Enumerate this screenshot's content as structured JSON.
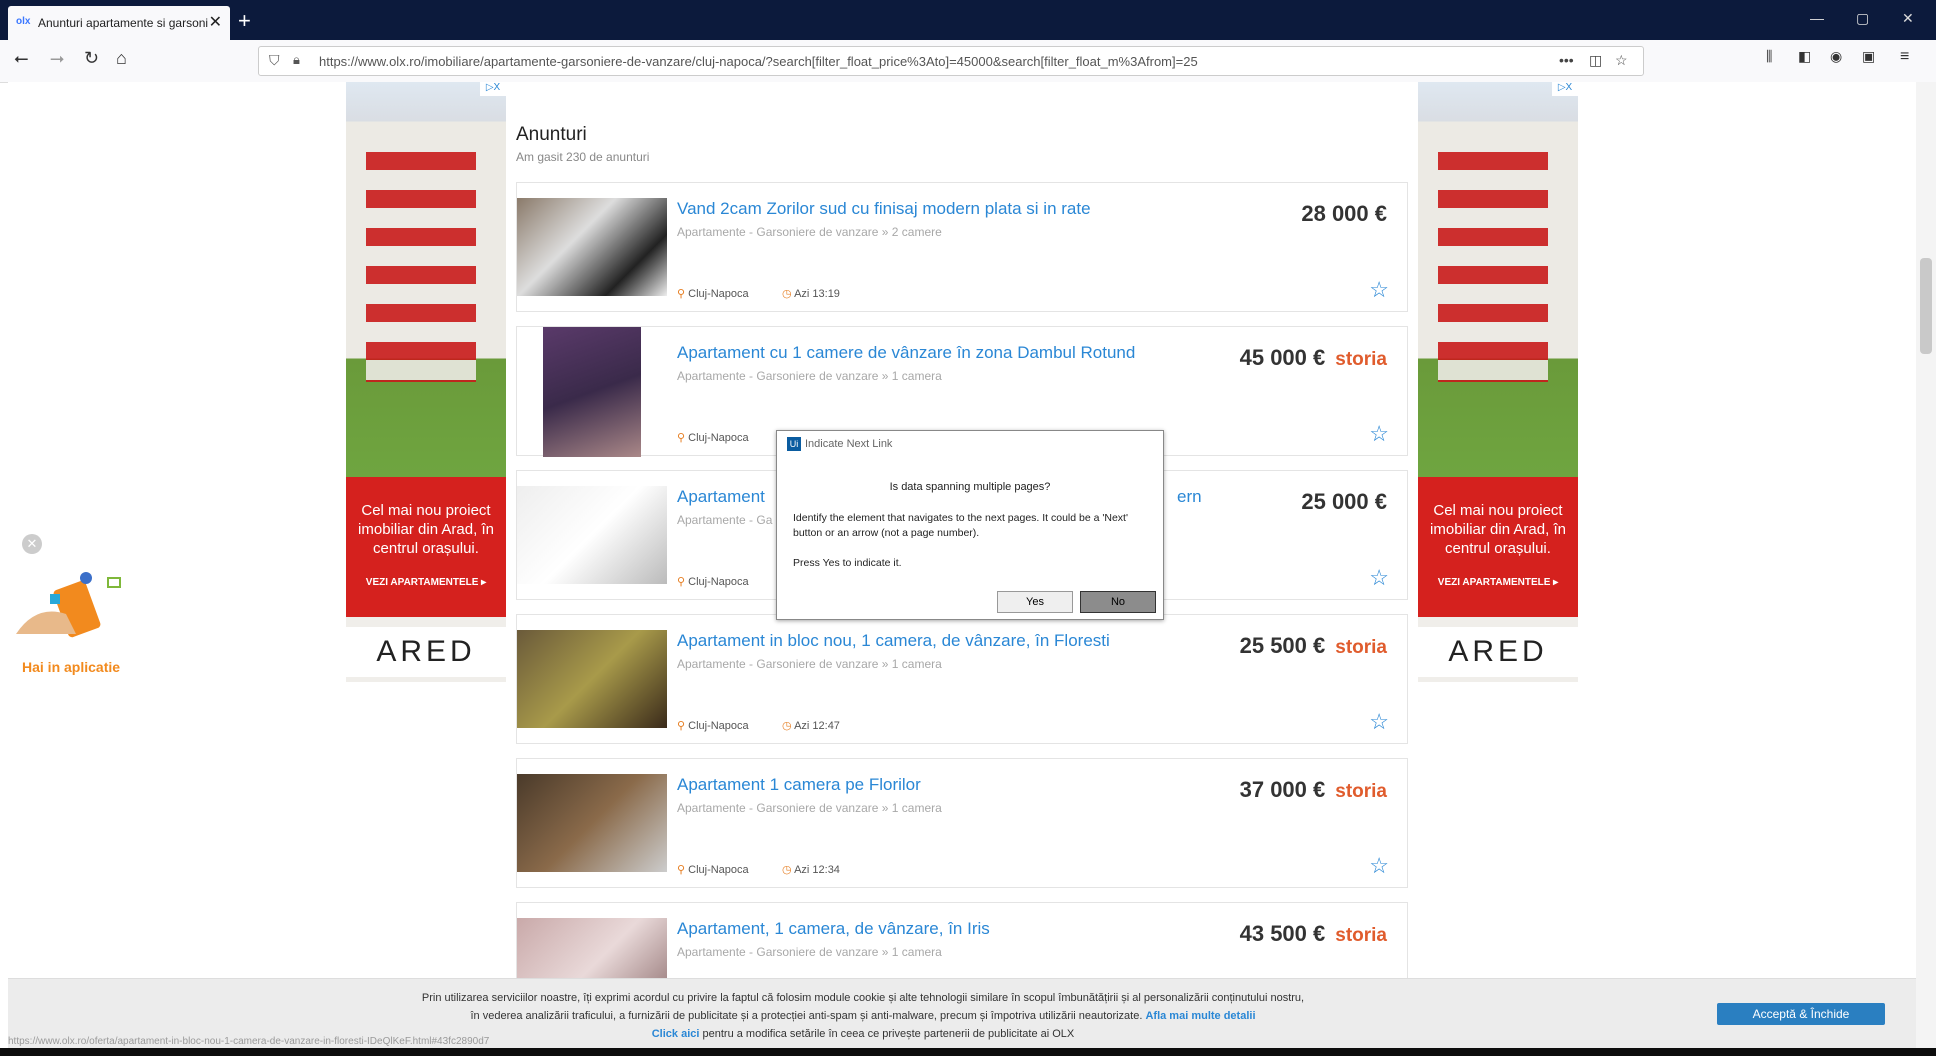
{
  "browser": {
    "tab_title": "Anunturi apartamente si garsoniere",
    "favicon": "olx",
    "new_tab": "+",
    "url": "https://www.olx.ro/imobiliare/apartamente-garsoniere-de-vanzare/cluj-napoca/?search[filter_float_price%3Ato]=45000&search[filter_float_m%3Afrom]=25",
    "win_min": "—",
    "win_max": "▢",
    "win_close": "✕"
  },
  "page": {
    "heading": "Anunturi",
    "subheading": "Am gasit 230 de anunturi"
  },
  "ads": {
    "text": "Cel mai nou proiect imobiliar din Arad, în centrul orașului.",
    "cta": "VEZI APARTAMENTELE ▸",
    "logo": "ARED",
    "adchoice": "▷X"
  },
  "listings": [
    {
      "title": "Vand 2cam Zorilor sud cu finisaj modern plata si in rate",
      "category": "Apartamente - Garsoniere de vanzare » 2 camere",
      "price": "28 000 €",
      "storia": "",
      "location": "Cluj-Napoca",
      "time": "Azi 13:19"
    },
    {
      "title": "Apartament cu 1 camere de vânzare în zona Dambul Rotund",
      "category": "Apartamente - Garsoniere de vanzare » 1 camera",
      "price": "45 000 €",
      "storia": "storia",
      "location": "Cluj-Napoca",
      "time": ""
    },
    {
      "title": "Apartament",
      "title_tail": "ern",
      "category": "Apartamente - Ga",
      "price": "25 000 €",
      "storia": "",
      "location": "Cluj-Napoca",
      "time": ""
    },
    {
      "title": "Apartament in bloc nou, 1 camera, de vânzare, în Floresti",
      "category": "Apartamente - Garsoniere de vanzare » 1 camera",
      "price": "25 500 €",
      "storia": "storia",
      "location": "Cluj-Napoca",
      "time": "Azi 12:47"
    },
    {
      "title": "Apartament 1 camera pe Florilor",
      "category": "Apartamente - Garsoniere de vanzare » 1 camera",
      "price": "37 000 €",
      "storia": "storia",
      "location": "Cluj-Napoca",
      "time": "Azi 12:34"
    },
    {
      "title": "Apartament, 1 camera, de vânzare, în Iris",
      "category": "Apartamente - Garsoniere de vanzare » 1 camera",
      "price": "43 500 €",
      "storia": "storia",
      "location": "",
      "time": ""
    }
  ],
  "dialog": {
    "title": "Indicate Next Link",
    "app_icon": "Ui",
    "question": "Is data spanning multiple pages?",
    "description": "Identify the element that navigates to the next pages. It could be a 'Next' button or an arrow (not a page number).",
    "instruction": "Press Yes to indicate it.",
    "yes_label": "Yes",
    "no_label": "No"
  },
  "promo": {
    "label": "Hai in aplicatie"
  },
  "cookie": {
    "line1": "Prin utilizarea serviciilor noastre, îți exprimi acordul cu privire la faptul că folosim module cookie și alte tehnologii similare în scopul îmbunătățirii și al personalizării conținutului nostru,",
    "line2": "în vederea analizării traficului, a furnizării de publicitate și a protecției anti-spam și anti-malware, precum și împotriva utilizării neautorizate.",
    "more_link": "Afla mai multe detalii",
    "click_link": "Click aici",
    "line3": "pentru a modifica setările în ceea ce privește partenerii de publicitate ai OLX",
    "accept": "Acceptă & Închide"
  },
  "status_url": "https://www.olx.ro/oferta/apartament-in-bloc-nou-1-camera-de-vanzare-in-floresti-IDeQlKeF.html#43fc2890d7"
}
